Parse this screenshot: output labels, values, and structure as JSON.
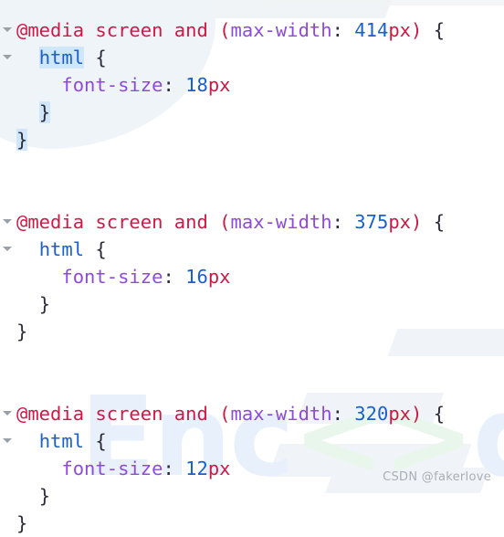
{
  "editor": {
    "language": "css",
    "theme": "light",
    "colors": {
      "background": "#ffffff",
      "atrule": "#d01846",
      "feature": "#8d4bdb",
      "property": "#8d4bdb",
      "number": "#1a5fd0",
      "unit": "#d01846",
      "selector": "#1a5fd0",
      "punctuation": "#2b2b3a",
      "selection_highlight": "#cfe6fb",
      "fold_marker": "#9aa0a6"
    },
    "fold_icon": "chevron-down-icon",
    "lines": [
      {
        "id": "line-1",
        "fold": true,
        "indent": 0,
        "tokens": [
          {
            "text": "@media screen and ",
            "type": "atrule"
          },
          {
            "text": "(",
            "type": "paren"
          },
          {
            "text": "max-width",
            "type": "feature"
          },
          {
            "text": ": ",
            "type": "punct"
          },
          {
            "text": "414",
            "type": "num"
          },
          {
            "text": "px",
            "type": "unit"
          },
          {
            "text": ")",
            "type": "paren"
          },
          {
            "text": " {",
            "type": "punct"
          }
        ]
      },
      {
        "id": "line-2",
        "fold": true,
        "indent": 1,
        "tokens": [
          {
            "text": "html",
            "type": "sel-hl"
          },
          {
            "text": " {",
            "type": "punct"
          }
        ]
      },
      {
        "id": "line-3",
        "fold": false,
        "indent": 2,
        "tokens": [
          {
            "text": "font-size",
            "type": "prop"
          },
          {
            "text": ": ",
            "type": "punct"
          },
          {
            "text": "18",
            "type": "num"
          },
          {
            "text": "px",
            "type": "unit"
          }
        ]
      },
      {
        "id": "line-4",
        "fold": false,
        "indent": 1,
        "tokens": [
          {
            "text": "}",
            "type": "punct-hl"
          }
        ]
      },
      {
        "id": "line-5",
        "fold": false,
        "indent": 0,
        "tokens": [
          {
            "text": "}",
            "type": "punct-hl"
          }
        ]
      },
      {
        "id": "line-6",
        "fold": false,
        "indent": 0,
        "tokens": []
      },
      {
        "id": "line-7",
        "fold": false,
        "indent": 0,
        "tokens": []
      },
      {
        "id": "line-8",
        "fold": true,
        "indent": 0,
        "tokens": [
          {
            "text": "@media screen and ",
            "type": "atrule"
          },
          {
            "text": "(",
            "type": "paren"
          },
          {
            "text": "max-width",
            "type": "feature"
          },
          {
            "text": ": ",
            "type": "punct"
          },
          {
            "text": "375",
            "type": "num"
          },
          {
            "text": "px",
            "type": "unit"
          },
          {
            "text": ")",
            "type": "paren"
          },
          {
            "text": " {",
            "type": "punct"
          }
        ]
      },
      {
        "id": "line-9",
        "fold": true,
        "indent": 1,
        "tokens": [
          {
            "text": "html",
            "type": "sel"
          },
          {
            "text": " {",
            "type": "punct"
          }
        ]
      },
      {
        "id": "line-10",
        "fold": false,
        "indent": 2,
        "tokens": [
          {
            "text": "font-size",
            "type": "prop"
          },
          {
            "text": ": ",
            "type": "punct"
          },
          {
            "text": "16",
            "type": "num"
          },
          {
            "text": "px",
            "type": "unit"
          }
        ]
      },
      {
        "id": "line-11",
        "fold": false,
        "indent": 1,
        "tokens": [
          {
            "text": "}",
            "type": "punct"
          }
        ]
      },
      {
        "id": "line-12",
        "fold": false,
        "indent": 0,
        "tokens": [
          {
            "text": "}",
            "type": "punct"
          }
        ]
      },
      {
        "id": "line-13",
        "fold": false,
        "indent": 0,
        "tokens": []
      },
      {
        "id": "line-14",
        "fold": false,
        "indent": 0,
        "tokens": []
      },
      {
        "id": "line-15",
        "fold": true,
        "indent": 0,
        "tokens": [
          {
            "text": "@media screen and ",
            "type": "atrule"
          },
          {
            "text": "(",
            "type": "paren"
          },
          {
            "text": "max-width",
            "type": "feature"
          },
          {
            "text": ": ",
            "type": "punct"
          },
          {
            "text": "320",
            "type": "num"
          },
          {
            "text": "px",
            "type": "unit"
          },
          {
            "text": ")",
            "type": "paren"
          },
          {
            "text": " {",
            "type": "punct"
          }
        ]
      },
      {
        "id": "line-16",
        "fold": true,
        "indent": 1,
        "tokens": [
          {
            "text": "html",
            "type": "sel"
          },
          {
            "text": " {",
            "type": "punct"
          }
        ]
      },
      {
        "id": "line-17",
        "fold": false,
        "indent": 2,
        "tokens": [
          {
            "text": "font-size",
            "type": "prop"
          },
          {
            "text": ": ",
            "type": "punct"
          },
          {
            "text": "12",
            "type": "num"
          },
          {
            "text": "px",
            "type": "unit"
          }
        ]
      },
      {
        "id": "line-18",
        "fold": false,
        "indent": 1,
        "tokens": [
          {
            "text": "}",
            "type": "punct"
          }
        ]
      },
      {
        "id": "line-19",
        "fold": false,
        "indent": 0,
        "tokens": [
          {
            "text": "}",
            "type": "punct"
          }
        ]
      }
    ]
  },
  "watermark": {
    "logo_text": "Enc",
    "logo_accent": "<>",
    "logo_tail": "de"
  },
  "attribution": {
    "text": "CSDN @fakerlove"
  }
}
